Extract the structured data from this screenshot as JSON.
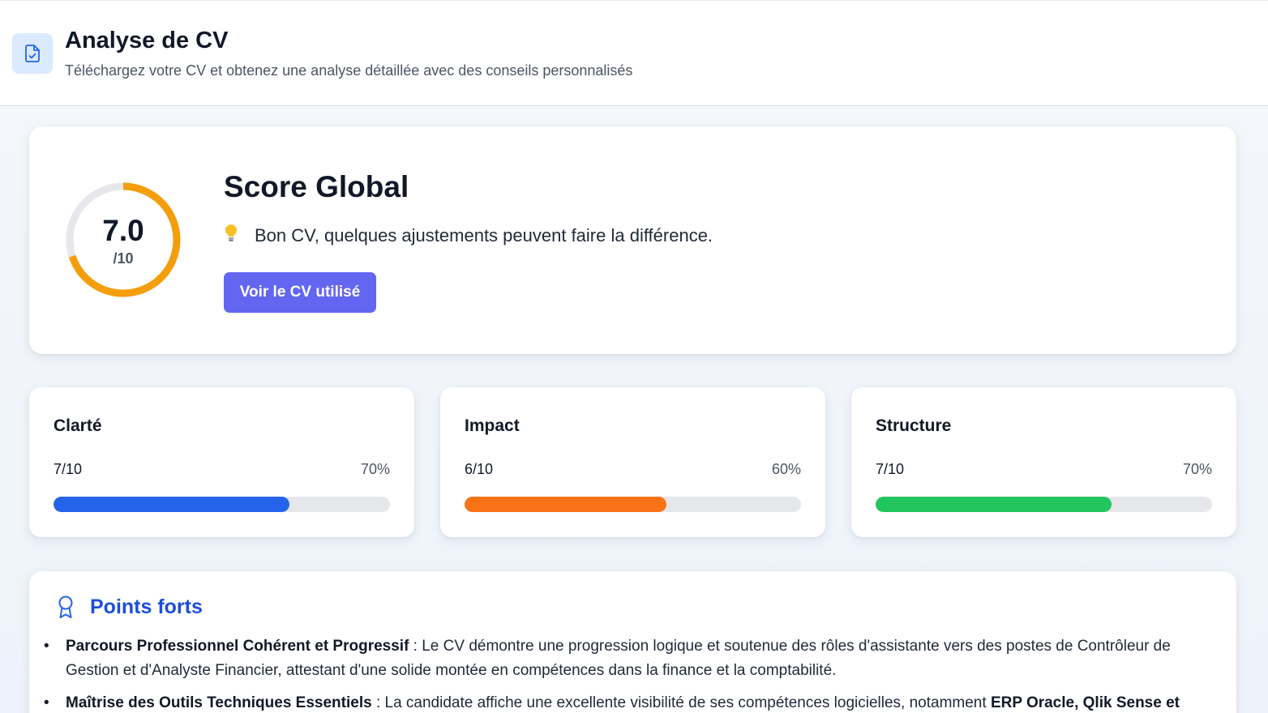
{
  "header": {
    "title": "Analyse de CV",
    "subtitle": "Téléchargez votre CV et obtenez une analyse détaillée avec des conseils personnalisés",
    "icon": "file-check-icon"
  },
  "score": {
    "value": "7.0",
    "max_label": "/10",
    "fraction": 0.7,
    "title": "Score Global",
    "message": "Bon CV, quelques ajustements peuvent faire la différence.",
    "message_icon": "lightbulb-icon",
    "button_label": "Voir le CV utilisé",
    "gauge_color": "#f59e0b",
    "track_color": "#e5e7eb"
  },
  "metrics": [
    {
      "label": "Clarté",
      "score": "7/10",
      "percent": "70%",
      "fraction": 0.7,
      "color": "#2563eb"
    },
    {
      "label": "Impact",
      "score": "6/10",
      "percent": "60%",
      "fraction": 0.6,
      "color": "#f97316"
    },
    {
      "label": "Structure",
      "score": "7/10",
      "percent": "70%",
      "fraction": 0.7,
      "color": "#22c55e"
    }
  ],
  "strengths": {
    "title": "Points forts",
    "icon": "award-ribbon-icon",
    "items": [
      {
        "title": "Parcours Professionnel Cohérent et Progressif",
        "text": " : Le CV démontre une progression logique et soutenue des rôles d'assistante vers des postes de Contrôleur de Gestion et d'Analyste Financier, attestant d'une solide montée en compétences dans la finance et la comptabilité.",
        "strong_tail": ""
      },
      {
        "title": "Maîtrise des Outils Techniques Essentiels",
        "text": " : La candidate affiche une excellente visibilité de ses compétences logicielles, notamment ",
        "strong_tail": "ERP Oracle, Qlik Sense et"
      }
    ]
  },
  "colors": {
    "accent_button": "#6366f1",
    "strengths_title": "#1d4ed8",
    "header_icon_bg": "#dbeafe"
  }
}
